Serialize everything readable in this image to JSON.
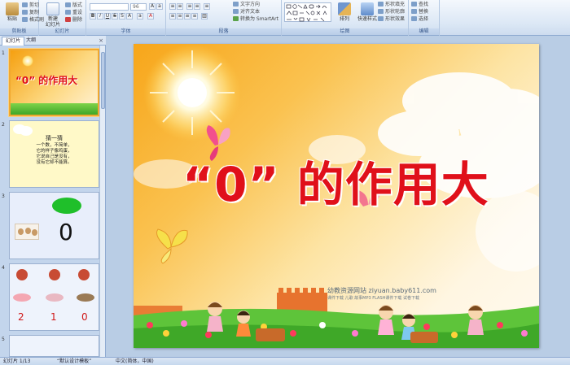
{
  "ribbon": {
    "groups": {
      "clipboard": "剪贴板",
      "slides": "幻灯片",
      "font": "字体",
      "paragraph": "段落",
      "drawing": "绘图",
      "editing": "编辑"
    },
    "paste": "粘贴",
    "cut": "剪切",
    "copy": "复制",
    "format_painter": "格式刷",
    "new_slide": "新建\n幻灯片",
    "layout": "版式",
    "reset": "重设",
    "delete": "删除",
    "font_size": "96",
    "text_direction": "文字方向",
    "align_text": "对齐文本",
    "convert_smartart": "转换为 SmartArt",
    "arrange": "排列",
    "quick_styles": "快速样式",
    "shape_fill": "形状填充",
    "shape_outline": "形状轮廓",
    "shape_effects": "形状效果",
    "find": "查找",
    "replace": "替换",
    "select": "选择"
  },
  "left_panel": {
    "tab_slides": "幻灯片",
    "tab_outline": "大纲",
    "close": "×",
    "slides": [
      {
        "num": "1",
        "title": "“0” 的作用大"
      },
      {
        "num": "2",
        "title": "猜一猜",
        "body": [
          "一个数，不简单，",
          "它的样子像鸡蛋，",
          "它说自己是没有，",
          "没有它却不能算。"
        ]
      },
      {
        "num": "3",
        "digit": "0"
      },
      {
        "num": "4",
        "digits": [
          "2",
          "1",
          "0"
        ]
      },
      {
        "num": "5"
      }
    ]
  },
  "slide": {
    "title": "“0” 的作用大",
    "watermark": "幼教资源网站  ziyuan.baby611.com",
    "watermark_sub": "课件下载  儿歌  故事MP3  FLASH课件下载  试卷下载"
  },
  "status_bar": {
    "slide_count": "幻灯片 1/13",
    "theme": "“默认设计模板”",
    "language": "中文(简体，中国)"
  },
  "colors": {
    "title_red": "#e0101a",
    "ribbon_blue": "#dbe7f5",
    "selection_orange": "#f0a830"
  }
}
